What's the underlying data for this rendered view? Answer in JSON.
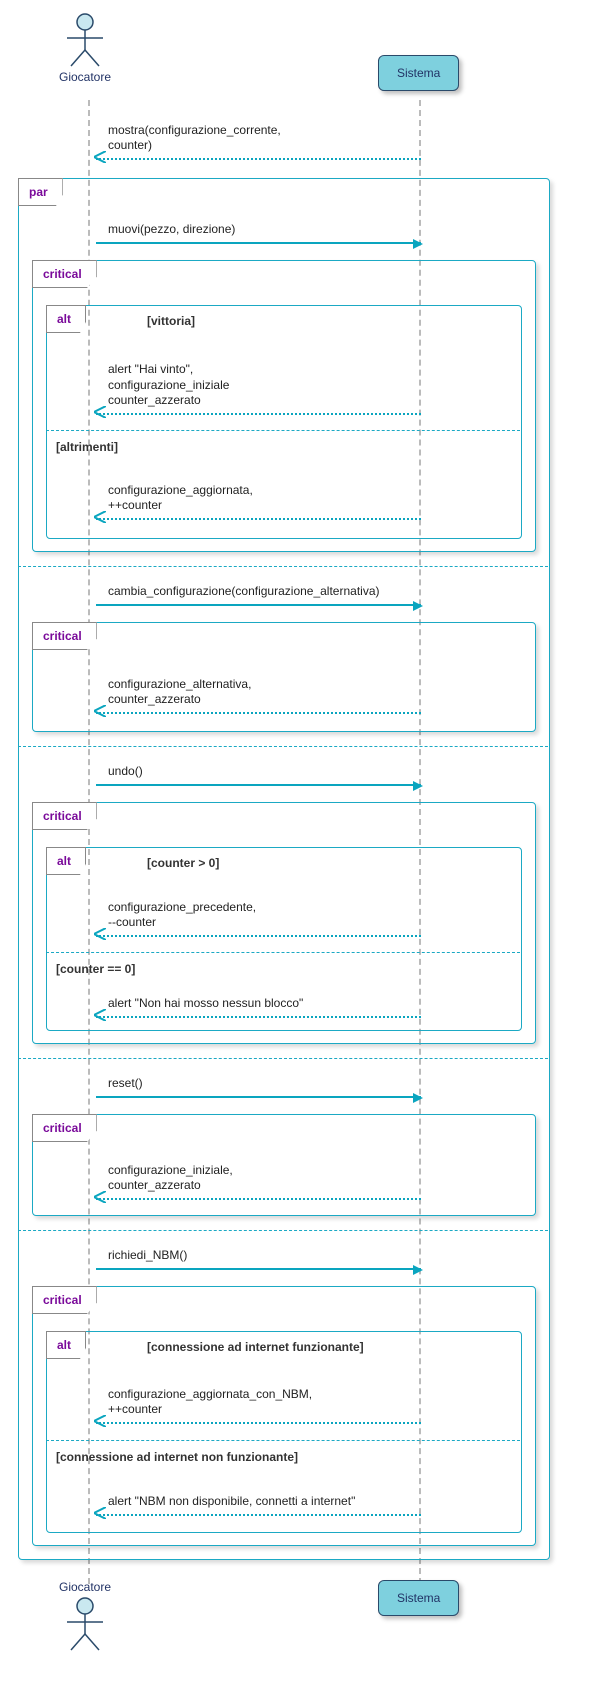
{
  "actors": {
    "giocatore_top": "Giocatore",
    "sistema_top": "Sistema",
    "giocatore_bottom": "Giocatore",
    "sistema_bottom": "Sistema"
  },
  "frames": {
    "par": "par",
    "critical": "critical",
    "alt": "alt"
  },
  "guards": {
    "vittoria": "[vittoria]",
    "altrimenti": "[altrimenti]",
    "counter_gt": "[counter > 0]",
    "counter_eq": "[counter == 0]",
    "conn_ok": "[connessione ad internet funzionante]",
    "conn_bad": "[connessione ad internet non funzionante]"
  },
  "messages": {
    "m1": "mostra(configurazione_corrente,\ncounter)",
    "m2": "muovi(pezzo, direzione)",
    "m3": "alert \"Hai vinto\",\nconfigurazione_iniziale\ncounter_azzerato",
    "m4": "configurazione_aggiornata,\n++counter",
    "m5": "cambia_configurazione(configurazione_alternativa)",
    "m6": "configurazione_alternativa,\ncounter_azzerato",
    "m7": "undo()",
    "m8": "configurazione_precedente,\n--counter",
    "m9": "alert \"Non hai mosso nessun blocco\"",
    "m10": "reset()",
    "m11": "configurazione_iniziale,\ncounter_azzerato",
    "m12": "richiedi_NBM()",
    "m13": "configurazione_aggiornata_con_NBM,\n++counter",
    "m14": "alert \"NBM non disponibile, connetti a internet\""
  }
}
